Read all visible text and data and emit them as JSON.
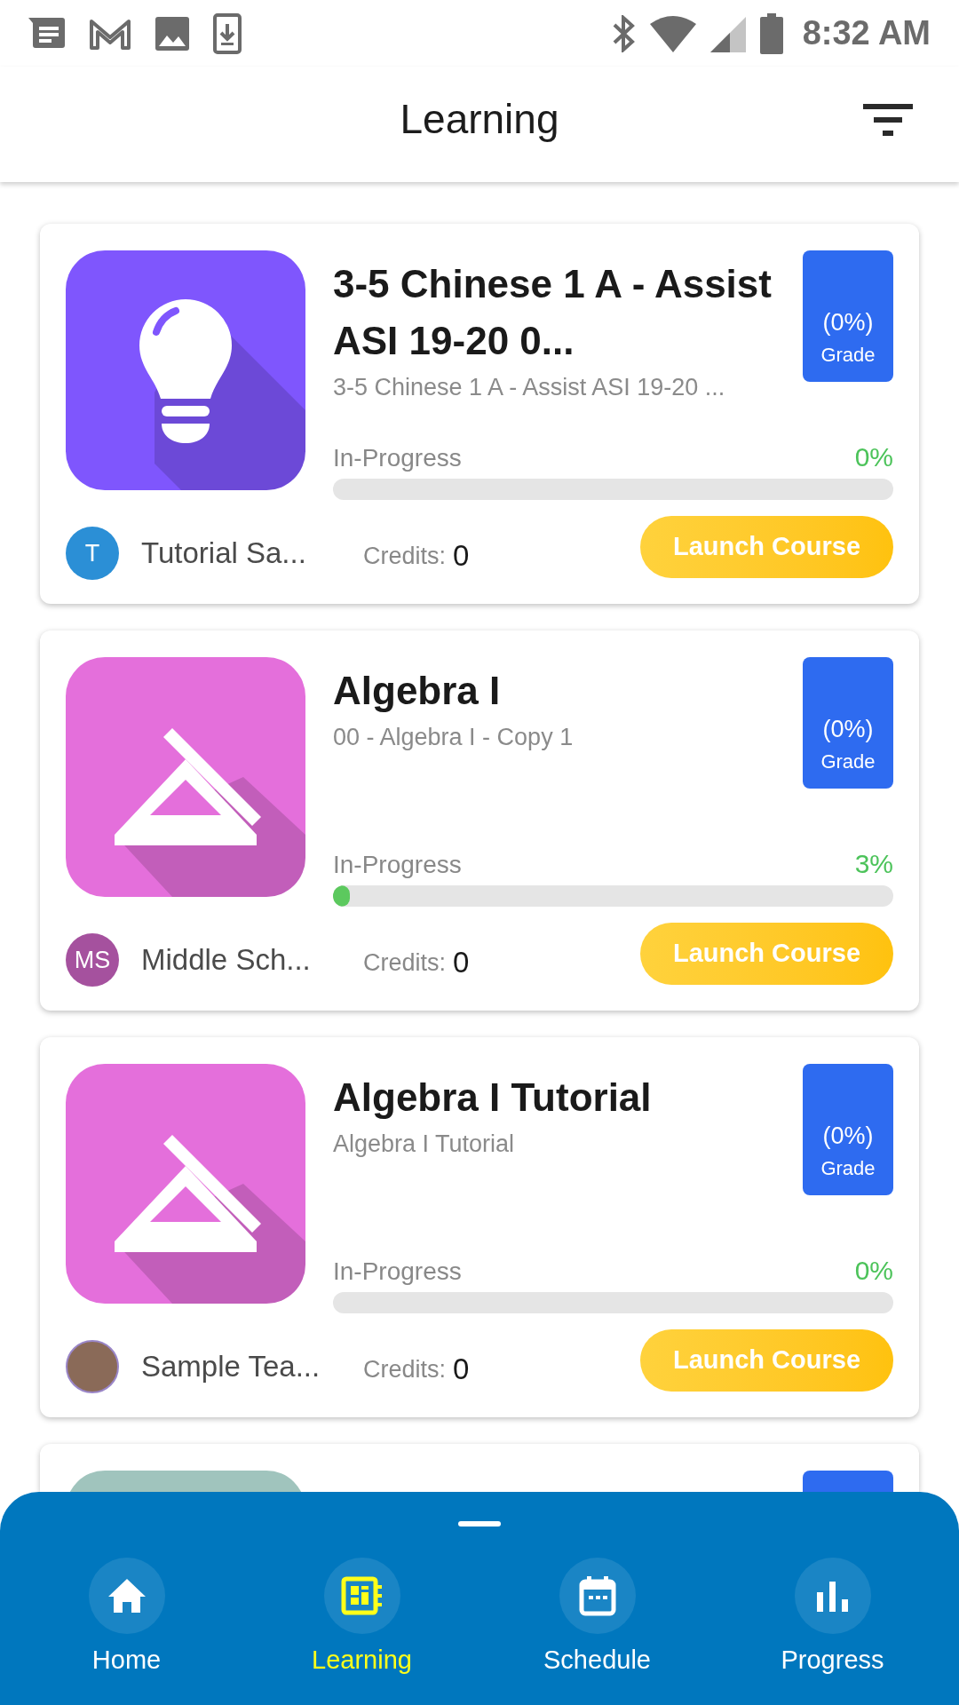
{
  "status_bar": {
    "time": "8:32 AM"
  },
  "header": {
    "title": "Learning"
  },
  "courses": [
    {
      "title": "3-5 Chinese 1 A - Assist ASI 19-20 0...",
      "subtitle": "3-5 Chinese 1 A - Assist ASI 19-20 ...",
      "kind": "bulb",
      "color": "#7f56fd",
      "grade": "(0%)",
      "grade_label": "Grade",
      "status": "In-Progress",
      "percent": "0%",
      "level": 0,
      "teacher": {
        "kind": "letter",
        "initials": "T",
        "color": "#2b8fd6",
        "name": "Tutorial Sa..."
      },
      "credits_label": "Credits:",
      "credits": "0",
      "button": "Launch Course"
    },
    {
      "title": "Algebra I",
      "subtitle": "00 - Algebra I - Copy 1",
      "kind": "ruler",
      "color": "#e46fdb",
      "grade": "(0%)",
      "grade_label": "Grade",
      "status": "In-Progress",
      "percent": "3%",
      "level": 0.03,
      "teacher": {
        "kind": "letter",
        "initials": "MS",
        "color": "#a5519e",
        "name": "Middle Sch..."
      },
      "credits_label": "Credits:",
      "credits": "0",
      "button": "Launch Course"
    },
    {
      "title": "Algebra I Tutorial",
      "subtitle": "Algebra I Tutorial",
      "kind": "ruler",
      "color": "#e46fdb",
      "grade": "(0%)",
      "grade_label": "Grade",
      "status": "In-Progress",
      "percent": "0%",
      "level": 0,
      "teacher": {
        "kind": "photo",
        "name": "Sample Tea..."
      },
      "credits_label": "Credits:",
      "credits": "0",
      "button": "Launch Course"
    },
    {
      "kind": "partial",
      "color": "#a0c4bd"
    }
  ],
  "nav": [
    {
      "label": "Home",
      "kind": "home",
      "selected": false
    },
    {
      "label": "Learning",
      "kind": "learning",
      "selected": true
    },
    {
      "label": "Schedule",
      "kind": "calendar",
      "selected": false
    },
    {
      "label": "Progress",
      "kind": "chart",
      "selected": false
    }
  ]
}
